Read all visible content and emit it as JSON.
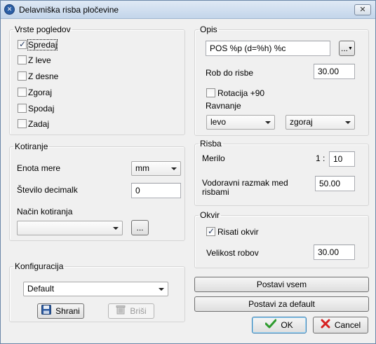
{
  "window": {
    "title": "Delavniška risba pločevine",
    "icon_name": "app-logo-icon",
    "close_icon": "close-icon"
  },
  "views": {
    "legend": "Vrste pogledov",
    "items": [
      {
        "label": "Spredaj",
        "checked": true
      },
      {
        "label": "Z leve",
        "checked": false
      },
      {
        "label": "Z desne",
        "checked": false
      },
      {
        "label": "Zgoraj",
        "checked": false
      },
      {
        "label": "Spodaj",
        "checked": false
      },
      {
        "label": "Zadaj",
        "checked": false
      }
    ]
  },
  "dimensioning": {
    "legend": "Kotiranje",
    "unit_label": "Enota mere",
    "unit_value": "mm",
    "decimals_label": "Število decimalk",
    "decimals_value": "0",
    "method_label": "Način kotiranja",
    "method_value": "",
    "browse_label": "..."
  },
  "configuration": {
    "legend": "Konfiguracija",
    "value": "Default",
    "save_label": "Shrani",
    "save_icon": "save-disk-icon",
    "delete_label": "Briši",
    "delete_icon": "trash-icon"
  },
  "description": {
    "legend": "Opis",
    "text_value": "POS %p (d=%h) %c",
    "menu_button_label": "...",
    "offset_label": "Rob do risbe",
    "offset_value": "30.00",
    "rotation_label": "Rotacija +90",
    "rotation_checked": false,
    "align_label": "Ravnanje",
    "align_h_value": "levo",
    "align_v_value": "zgoraj"
  },
  "drawing": {
    "legend": "Risba",
    "scale_label": "Merilo",
    "scale_prefix": "1 :",
    "scale_value": "10",
    "spacing_label_line1": "Vodoravni razmak med",
    "spacing_label_line2": "risbami",
    "spacing_value": "50.00"
  },
  "frame": {
    "legend": "Okvir",
    "draw_label": "Risati okvir",
    "draw_checked": true,
    "size_label": "Velikost robov",
    "size_value": "30.00"
  },
  "actions": {
    "set_all_label": "Postavi vsem",
    "set_default_label": "Postavi za default",
    "ok_label": "OK",
    "ok_icon": "checkmark-icon",
    "cancel_label": "Cancel",
    "cancel_icon": "red-x-icon"
  }
}
